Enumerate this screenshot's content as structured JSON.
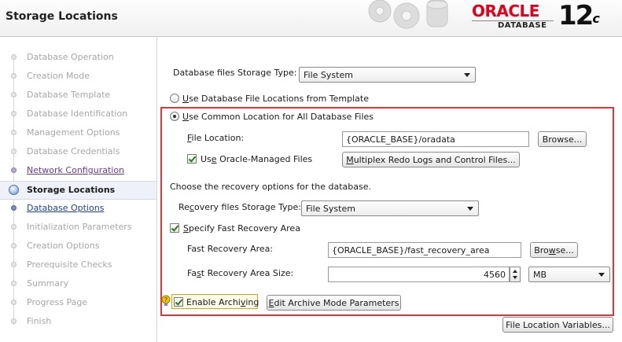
{
  "header": {
    "title": "Storage Locations",
    "brand_name": "ORACLE",
    "brand_product": "DATABASE",
    "brand_version": "12",
    "brand_version_suffix": "c",
    "brand_color": "#e2001a"
  },
  "sidebar": {
    "steps": [
      {
        "label": "Database Operation",
        "state": "disabled"
      },
      {
        "label": "Creation Mode",
        "state": "disabled"
      },
      {
        "label": "Database Template",
        "state": "disabled"
      },
      {
        "label": "Database Identification",
        "state": "disabled"
      },
      {
        "label": "Management Options",
        "state": "disabled"
      },
      {
        "label": "Database Credentials",
        "state": "disabled"
      },
      {
        "label": "Network Configuration",
        "state": "link"
      },
      {
        "label": "Storage Locations",
        "state": "current"
      },
      {
        "label": "Database Options",
        "state": "link"
      },
      {
        "label": "Initialization Parameters",
        "state": "disabled"
      },
      {
        "label": "Creation Options",
        "state": "disabled"
      },
      {
        "label": "Prerequisite Checks",
        "state": "disabled"
      },
      {
        "label": "Summary",
        "state": "disabled"
      },
      {
        "label": "Progress Page",
        "state": "disabled"
      },
      {
        "label": "Finish",
        "state": "disabled"
      }
    ]
  },
  "main": {
    "storage_type_label": "Database files Storage Type:",
    "storage_type_value": "File System",
    "radio_template_label_u": "U",
    "radio_template_label_rest": "se Database File Locations from Template",
    "radio_common_label_u": "U",
    "radio_common_label_rest": "se Common Location for All Database Files",
    "file_location_label_u": "F",
    "file_location_label_rest": "ile Location:",
    "file_location_value": "{ORACLE_BASE}/oradata",
    "browse_label_1": "Browse...",
    "omf_label_pre": "Us",
    "omf_label_u": "e",
    "omf_label_rest": " Oracle-Managed Files",
    "multiplex_label_u": "M",
    "multiplex_label_rest": "ultiplex Redo Logs and Control Files...",
    "recovery_intro": "Choose the recovery options for the database.",
    "recovery_storage_label_pre": "Re",
    "recovery_storage_label_u": "c",
    "recovery_storage_label_rest": "overy files Storage Type:",
    "recovery_storage_value": "File System",
    "specify_fra_label_u": "S",
    "specify_fra_label_rest": "pecify Fast Recovery Area",
    "fra_label": "Fast Recovery Area:",
    "fra_value": "{ORACLE_BASE}/fast_recovery_area",
    "browse_label_2_pre": "Bro",
    "browse_label_2_u": "w",
    "browse_label_2_rest": "se...",
    "fra_size_label_pre": "Fa",
    "fra_size_label_u": "s",
    "fra_size_label_rest": "t Recovery Area Size:",
    "fra_size_value": "4560",
    "fra_size_unit": "MB",
    "archiving_label_pre": "Enable Archi",
    "archiving_label_u": "v",
    "archiving_label_rest": "ing",
    "archive_params_label_u": "E",
    "archive_params_label_rest": "dit Archive Mode Parameters",
    "file_location_vars_label": "File Location Variables...",
    "highlight_color": "#e0383a"
  }
}
